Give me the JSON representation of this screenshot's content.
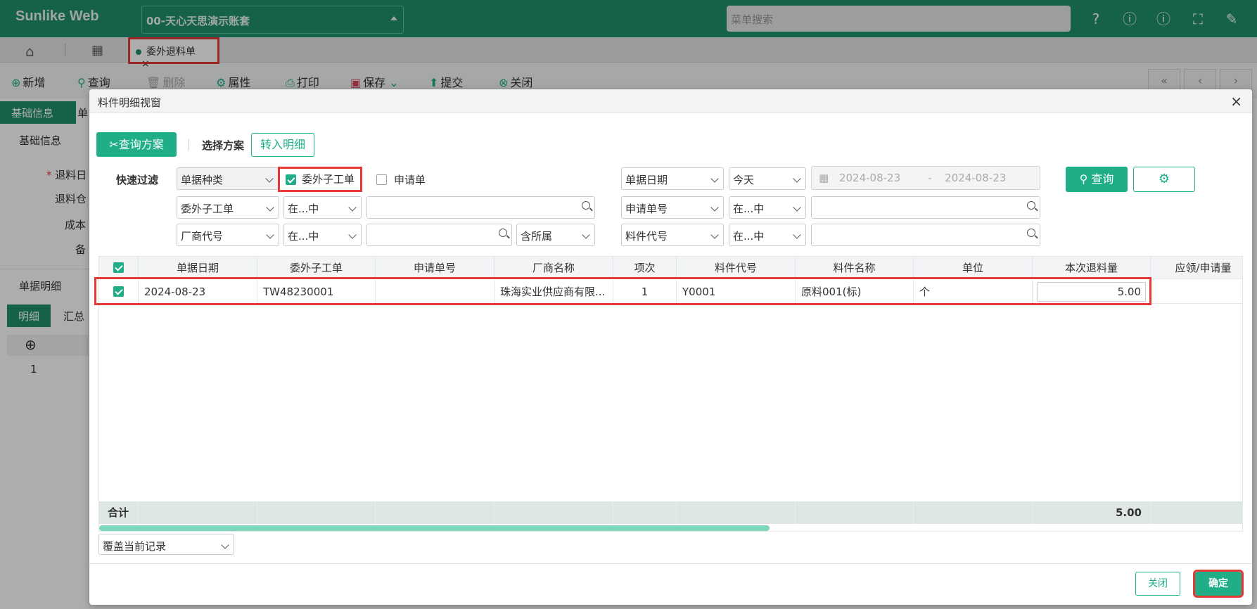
{
  "app": {
    "logo": "Sunlike Web",
    "account": "00-天心天思演示账套",
    "search_placeholder": "菜单搜索"
  },
  "tabs": [
    {
      "label": "委外退料单",
      "close": "×"
    }
  ],
  "toolbar": {
    "new": "新增",
    "query": "查询",
    "delete": "删除",
    "props": "属性",
    "print": "打印",
    "save": "保存",
    "submit": "提交",
    "close": "关闭"
  },
  "background": {
    "tab_basic": "基础信息",
    "tab_other": "单",
    "section_basic": "基础信息",
    "field_date": "退料日",
    "field_wh": "退料仓",
    "field_cost": "成本",
    "field_note": "备",
    "detail_title": "单据明细",
    "subtab_detail": "明细",
    "subtab_summary": "汇总",
    "row1": "1"
  },
  "modal": {
    "title": "料件明细视窗",
    "close": "×",
    "query_scheme": "查询方案",
    "select_scheme": "选择方案",
    "to_detail": "转入明细",
    "quick_filter": "快速过滤",
    "doc_type": "单据种类",
    "chk_outsource": "委外子工单",
    "chk_request": "申请单",
    "doc_date": "单据日期",
    "today": "今天",
    "date_from": "2024-08-23",
    "date_sep": "-",
    "date_to": "2024-08-23",
    "query_btn": "查询",
    "f_outsource": "委外子工单",
    "op1": "在...中",
    "f_request_no": "申请单号",
    "op2": "在...中",
    "f_vendor": "厂商代号",
    "op3": "在...中",
    "contains": "含所属",
    "f_item": "料件代号",
    "op4": "在...中",
    "columns": [
      "单据日期",
      "委外子工单",
      "申请单号",
      "厂商名称",
      "项次",
      "料件代号",
      "料件名称",
      "单位",
      "本次退料量",
      "应领/申请量"
    ],
    "rows": [
      {
        "date": "2024-08-23",
        "order": "TW48230001",
        "req": "",
        "vendor": "珠海实业供应商有限...",
        "seq": "1",
        "item": "Y0001",
        "name": "原料001(标)",
        "unit": "个",
        "qty": "5.00"
      }
    ],
    "total_label": "合计",
    "total_qty": "5.00",
    "mode": "覆盖当前记录",
    "close_btn": "关闭",
    "ok_btn": "确定"
  }
}
